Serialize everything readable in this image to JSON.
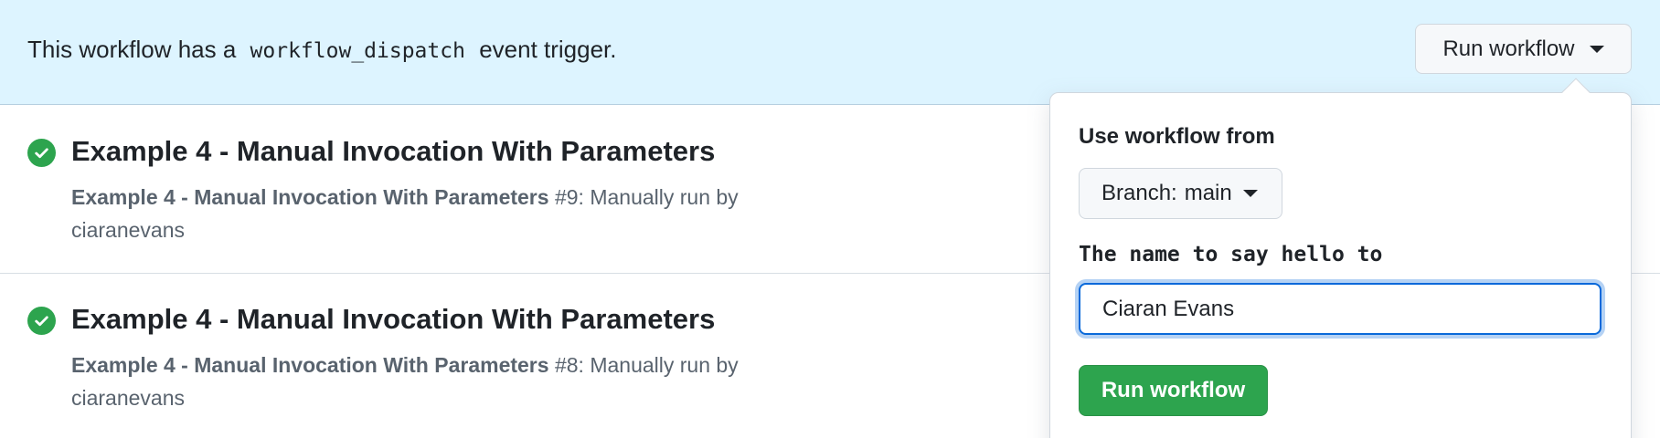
{
  "banner": {
    "text_before": "This workflow has a",
    "code": "workflow_dispatch",
    "text_after": "event trigger.",
    "run_button_label": "Run workflow"
  },
  "runs": [
    {
      "title": "Example 4 - Manual Invocation With Parameters",
      "workflow_name": "Example 4 - Manual Invocation With Parameters",
      "run_number": "#9",
      "event_text": ": Manually run by",
      "actor": "ciaranevans",
      "status": "success"
    },
    {
      "title": "Example 4 - Manual Invocation With Parameters",
      "workflow_name": "Example 4 - Manual Invocation With Parameters",
      "run_number": "#8",
      "event_text": ": Manually run by",
      "actor": "ciaranevans",
      "status": "success"
    }
  ],
  "dropdown": {
    "use_workflow_label": "Use workflow from",
    "branch_prefix": "Branch:",
    "branch_name": "main",
    "input_label": "The name to say hello to",
    "input_value": "Ciaran Evans",
    "submit_label": "Run workflow"
  },
  "colors": {
    "banner_bg": "#ddf4ff",
    "success": "#2da44e",
    "primary_button": "#2da44e",
    "focus_ring": "#0969da"
  },
  "icons": {
    "status": "check-circle-icon",
    "caret": "triangle-down-icon"
  }
}
